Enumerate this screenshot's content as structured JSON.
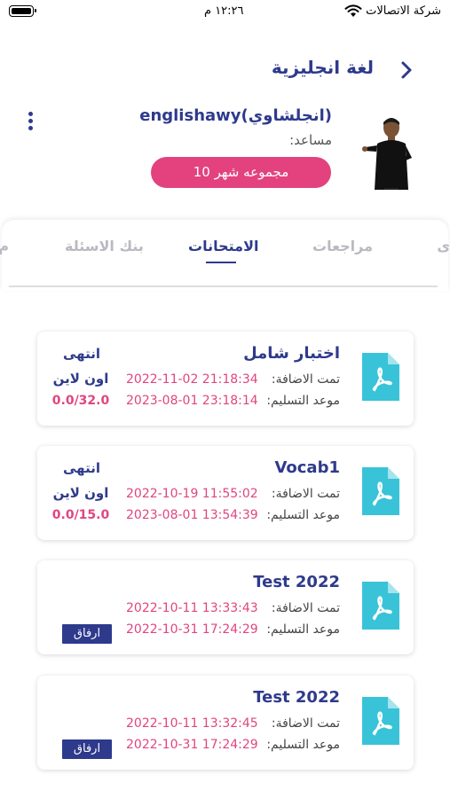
{
  "status_bar": {
    "carrier": "شركة الاتصالات",
    "time": "١٢:٢٦ م"
  },
  "header": {
    "title": "لغة انجليزية"
  },
  "teacher": {
    "name": "(انجلشاوي)englishawy",
    "role_label": "مساعد:",
    "group": "مجموعه شهر 10"
  },
  "tabs": [
    {
      "label": "مراجعات",
      "active": false
    },
    {
      "label": "الامتحانات",
      "active": true
    },
    {
      "label": "بنك الاسئلة",
      "active": false
    }
  ],
  "exams": [
    {
      "title": "اختبار شامل",
      "added_label": "تمت الاضافة:",
      "added": "2022-11-02 21:18:34",
      "due_label": "موعد التسليم:",
      "due": "2023-08-01 23:18:14",
      "status": "انتهى",
      "mode": "اون لاين",
      "score": "0.0/32.0"
    },
    {
      "title": "Vocab1",
      "added_label": "تمت الاضافة:",
      "added": "2022-10-19 11:55:02",
      "due_label": "موعد التسليم:",
      "due": "2023-08-01 13:54:39",
      "status": "انتهى",
      "mode": "اون لاين",
      "score": "0.0/15.0"
    },
    {
      "title": "Test 2022",
      "added_label": "تمت الاضافة:",
      "added": "2022-10-11 13:33:43",
      "due_label": "موعد التسليم:",
      "due": "2022-10-31 17:24:29",
      "attach": "ارفاق"
    },
    {
      "title": "Test 2022",
      "added_label": "تمت الاضافة:",
      "added": "2022-10-11 13:32:45",
      "due_label": "موعد التسليم:",
      "due": "2022-10-31 17:24:29",
      "attach": "ارفاق"
    }
  ],
  "colors": {
    "primary": "#2e3a8c",
    "accent": "#e3427f",
    "icon": "#39c3d8"
  }
}
